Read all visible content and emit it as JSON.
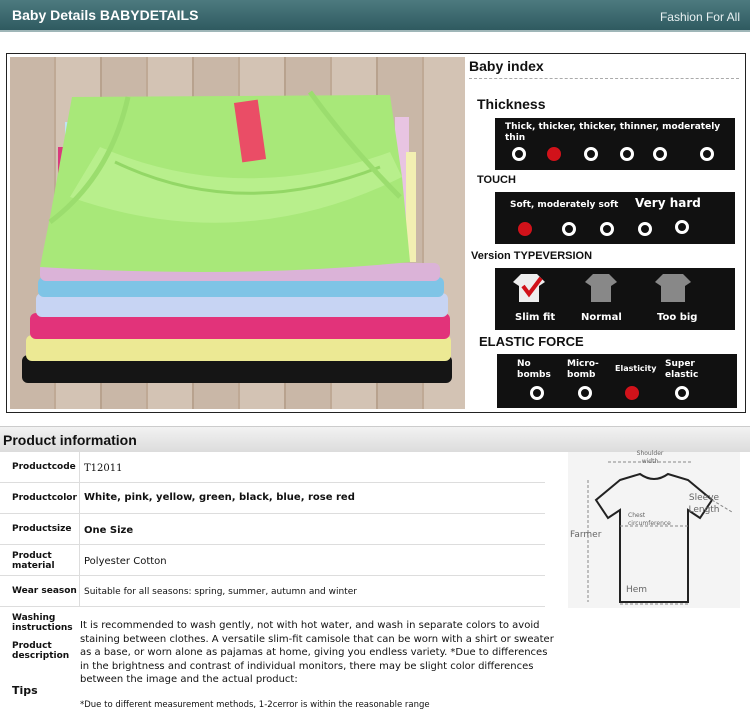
{
  "header": {
    "title": "Baby Details BABYDETAILS",
    "tagline": "Fashion For All"
  },
  "baby_index": {
    "title": "Baby index",
    "thickness": {
      "title": "Thickness",
      "options_label": "Thick, thicker, thicker, thinner, moderately thin",
      "dot_count": 6,
      "selected_index": 1
    },
    "touch": {
      "title": "TOUCH",
      "soft_label": "Soft, moderately soft",
      "hard_label": "Very hard",
      "dot_count": 5,
      "selected_index": 0
    },
    "version": {
      "title": "Version TYPEVERSION",
      "options": [
        "Slim fit",
        "Normal",
        "Too big"
      ],
      "selected_index": 0
    },
    "elastic": {
      "title": "ELASTIC FORCE",
      "options": [
        "No bombs",
        "Micro-bomb",
        "Elasticity",
        "Super elastic"
      ],
      "selected_index": 2
    }
  },
  "product_info": {
    "title": "Product information",
    "rows": [
      {
        "label": "Productcode",
        "value": "T12011"
      },
      {
        "label": "Productcolor",
        "value": "White, pink, yellow, green, black, blue, rose red"
      },
      {
        "label": "Productsize",
        "value": "One Size"
      },
      {
        "label": "Product material",
        "value": "Polyester Cotton"
      },
      {
        "label": "Wear season",
        "value": "Suitable for all seasons: spring, summer, autumn and winter"
      },
      {
        "label": "Washing instructions",
        "value": ""
      },
      {
        "label": "Product description",
        "value": ""
      },
      {
        "label": "Tips",
        "value": ""
      }
    ],
    "description": "It is recommended to wash gently, not with hot water, and wash in separate colors to avoid staining between clothes. A versatile slim-fit camisole that can be worn with a shirt or sweater as a base, or worn alone as pajamas at home, giving you endless variety. *Due to differences in the brightness and contrast of individual monitors, there may be slight color differences between the image and the actual product:",
    "tips_note": "*Due to different measurement methods, 1-2cerror is within the reasonable range"
  },
  "size_diagram": {
    "shoulder": "Shoulder width",
    "sleeve": "Sleeve Length",
    "farmer": "Farmer",
    "chest": "Chest circumference",
    "hem": "Hem"
  },
  "colors": {
    "header_bg": "#3c666c",
    "accent_red": "#d1121a",
    "panel_dark": "#111111"
  },
  "icons": {
    "product_photo": "stacked-camisoles-photo",
    "version_shirt": "shirt-icon"
  }
}
